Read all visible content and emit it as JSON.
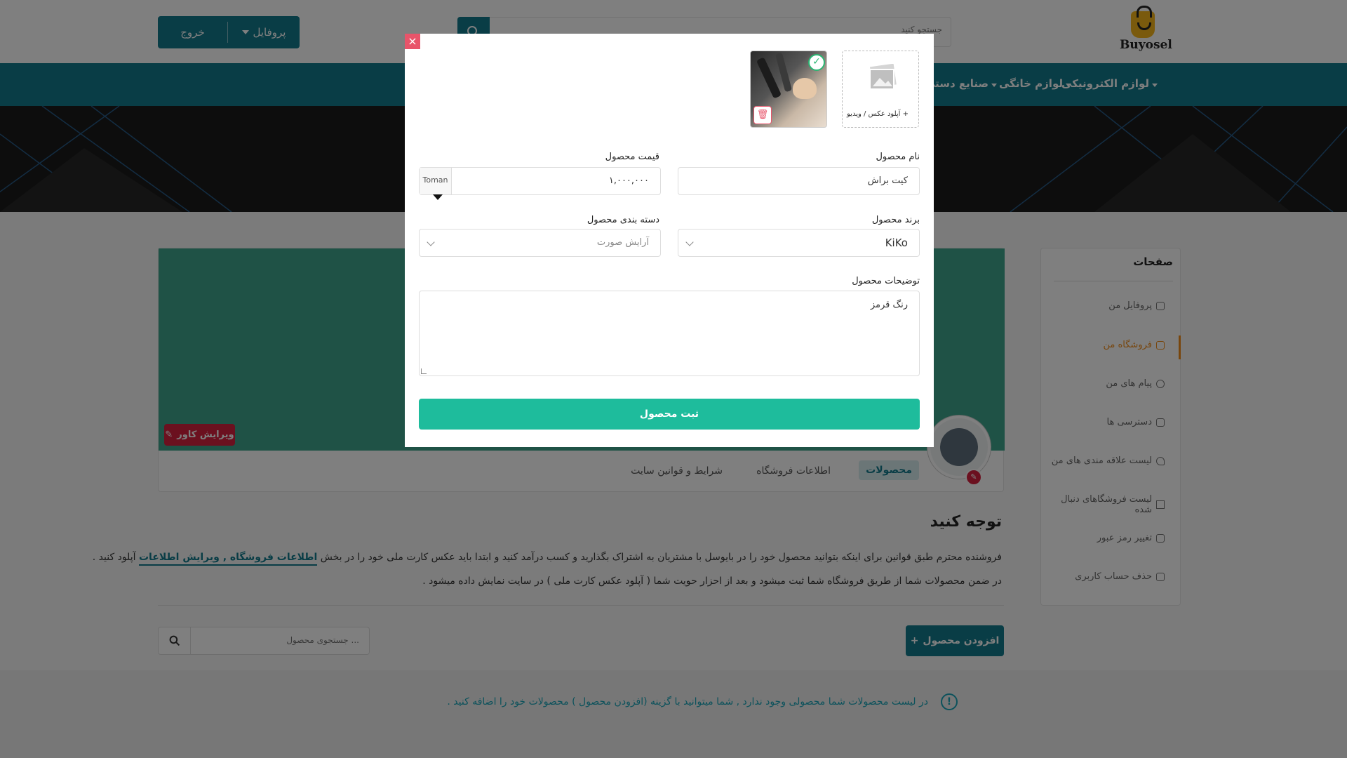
{
  "header": {
    "logo_text": "Buyosel",
    "search_placeholder": "جستجو کنید",
    "exit_label": "خروج",
    "profile_label": "پروفایل"
  },
  "nav": {
    "items": [
      {
        "label": "لوازم الکترونیکی"
      },
      {
        "label": "لوازم خانگی"
      },
      {
        "label": "صنایع دستی"
      }
    ]
  },
  "sidebar": {
    "title": "صفحات",
    "items": [
      {
        "label": "پروفایل من"
      },
      {
        "label": "فروشگاه من"
      },
      {
        "label": "پیام های من"
      },
      {
        "label": "دسترسی ها"
      },
      {
        "label": "لیست علاقه مندی های من"
      },
      {
        "label": "لیست فروشگاهای دنبال شده"
      },
      {
        "label": "تغییر رمز عبور"
      },
      {
        "label": "حذف حساب کاربری"
      }
    ]
  },
  "store": {
    "edit_cover_label": "ویرایش کاور",
    "tabs": [
      {
        "label": "محصولات"
      },
      {
        "label": "اطلاعات فروشگاه"
      },
      {
        "label": "شرایط و قوانین سایت"
      }
    ]
  },
  "notice": {
    "title": "توجه کنید",
    "line1_before": "فروشنده محترم طبق قوانین برای اینکه بتوانید محصول خود را در بایوسل با مشتریان به اشتراک بگذارید و کسب درآمد کنید و ابتدا باید عکس کارت ملی خود را در بخش",
    "line1_link": "اطلاعات فروشگاه , ویرایش اطلاعات",
    "line1_after": "آپلود کنید .",
    "line2": "در ضمن محصولات شما از طریق فروشگاه شما ثبت میشود و بعد از احزار حویت شما ( آپلود عکس کارت ملی ) در سایت نمایش داده میشود ."
  },
  "products": {
    "add_label": "افزودن محصول",
    "search_placeholder": "جستجوی محصول ...",
    "empty_message": "در لیست محصولات شما محصولی وجود ندارد , شما میتوانید با گزینه (افزودن محصول ) محصولات خود را اضافه کنید ."
  },
  "modal": {
    "close_symbol": "×",
    "upload_label": "+ آپلود عکس / ویدیو",
    "name_label": "نام محصول",
    "name_value": "کیت براش",
    "price_label": "قیمت محصول",
    "price_value": "۱,۰۰۰,۰۰۰",
    "price_currency": "Toman",
    "brand_label": "برند محصول",
    "brand_value": "KiKo",
    "category_label": "دسته بندی محصول",
    "category_value": "آرایش صورت",
    "description_label": "توضیحات محصول",
    "description_value": "رنگ قرمز",
    "submit_label": "ثبت محصول"
  },
  "colors": {
    "primary": "#127a8c",
    "submit": "#1ebc9c",
    "danger": "#d7213f",
    "active_sidebar": "#f08c1a",
    "cover": "#3ea58c"
  }
}
